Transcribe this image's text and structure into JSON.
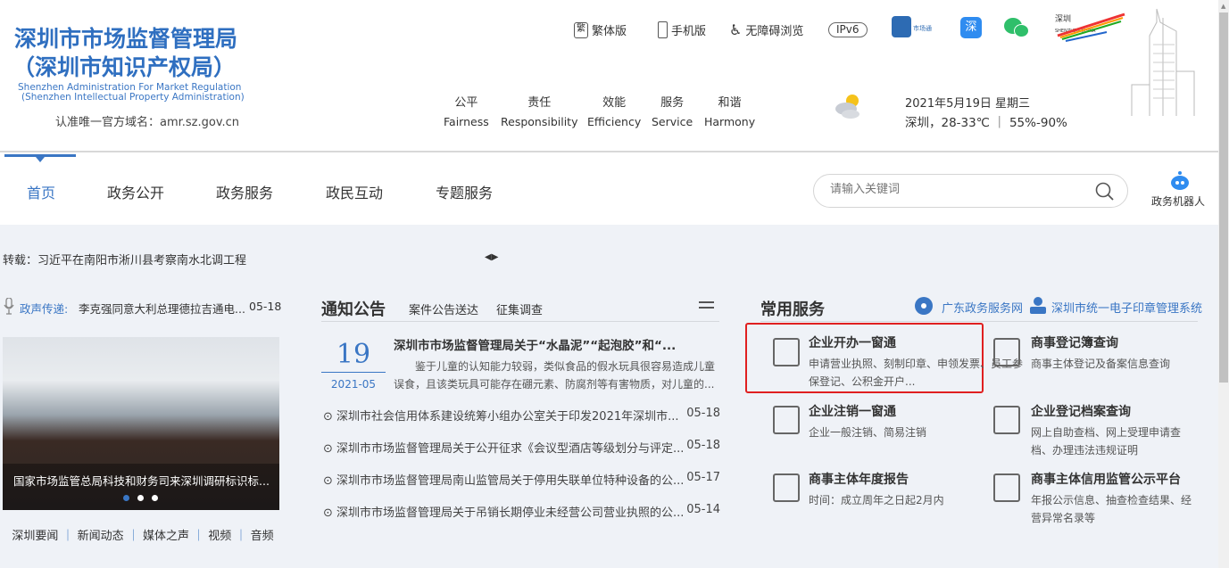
{
  "header": {
    "title_line1": "深圳市市场监督管理局",
    "title_line2": "（深圳市知识产权局）",
    "en_line1": "Shenzhen Administration For Market Regulation",
    "en_line2": "(Shenzhen Intellectual Property Administration)",
    "domain": "认准唯一官方域名：amr.sz.gov.cn",
    "tools": [
      {
        "label": "繁体版",
        "icon": "traditional-chinese-icon"
      },
      {
        "label": "手机版",
        "icon": "mobile-icon"
      },
      {
        "label": "无障碍浏览",
        "icon": "accessibility-icon"
      },
      {
        "label": "IPv6"
      }
    ],
    "apps": [
      {
        "label": "市场通",
        "icon": "shichangtong-app-icon"
      },
      {
        "label": "i深",
        "icon": "ishen-app-icon"
      },
      {
        "label": "",
        "icon": "wechat-icon"
      },
      {
        "label": "深圳 SHENZHEN CHINA",
        "icon": "shenzhen-logo"
      }
    ],
    "values": [
      {
        "cn": "公平",
        "en": "Fairness"
      },
      {
        "cn": "责任",
        "en": "Responsibility"
      },
      {
        "cn": "效能",
        "en": "Efficiency"
      },
      {
        "cn": "服务",
        "en": "Service"
      },
      {
        "cn": "和谐",
        "en": "Harmony"
      }
    ],
    "weather": {
      "icon": "partly-cloudy-icon",
      "date": "2021年5月19日 星期三",
      "line": "深圳，28-33℃ ｜ 55%-90%"
    }
  },
  "nav": {
    "items": [
      "首页",
      "政务公开",
      "政务服务",
      "政民互动",
      "专题服务"
    ],
    "active": 0,
    "search_placeholder": "请输入关键词",
    "robot": "政务机器人"
  },
  "ticker": {
    "text": "转载：习近平在南阳市淅川县考察南水北调工程"
  },
  "left": {
    "voice_label": "政声传递:",
    "voice_title": "李克强同意大利总理德拉吉通电...",
    "voice_date": "05-18",
    "slide_caption": "国家市场监管总局科技和财务司来深圳调研标识标...",
    "slide_active": 0,
    "slide_count": 3,
    "links": [
      "深圳要闻",
      "新闻动态",
      "媒体之声",
      "视频",
      "音频"
    ]
  },
  "notice": {
    "title": "通知公告",
    "tabs": [
      "案件公告送达",
      "征集调查"
    ],
    "featured": {
      "day": "19",
      "month": "2021-05",
      "title": "深圳市市场监督管理局关于“水晶泥”“起泡胶”和“...",
      "summary": "鉴于儿童的认知能力较弱，类似食品的假水玩具很容易造成儿童误食，且该类玩具可能存在硼元素、防腐剂等有害物质，对儿童的..."
    },
    "items": [
      {
        "title": "深圳市社会信用体系建设统筹小组办公室关于印发2021年深圳市...",
        "date": "05-18"
      },
      {
        "title": "深圳市市场监督管理局关于公开征求《会议型酒店等级划分与评定...",
        "date": "05-18"
      },
      {
        "title": "深圳市市场监督管理局南山监管局关于停用失联单位特种设备的公...",
        "date": "05-17"
      },
      {
        "title": "深圳市市场监督管理局关于吊销长期停业未经营公司营业执照的公...",
        "date": "05-14"
      }
    ]
  },
  "services": {
    "title": "常用服务",
    "links": [
      "广东政务服务网",
      "深圳市统一电子印章管理系统"
    ],
    "items": [
      {
        "title": "企业开办一窗通",
        "desc": "申请营业执照、刻制印章、申领发票、员工参保登记、公积金开户...",
        "icon": "building-icon",
        "highlighted": true
      },
      {
        "title": "商事登记簿查询",
        "desc": "商事主体登记及备案信息查询",
        "icon": "document-search-icon"
      },
      {
        "title": "企业注销一窗通",
        "desc": "企业一般注销、简易注销",
        "icon": "power-monitor-icon"
      },
      {
        "title": "企业登记档案查询",
        "desc": "网上自助查档、网上受理申请查档、办理违法违规证明",
        "icon": "archive-tray-icon"
      },
      {
        "title": "商事主体年度报告",
        "desc": "时间：成立周年之日起2月内",
        "icon": "report-icon"
      },
      {
        "title": "商事主体信用监管公示平台",
        "desc": "年报公示信息、抽查检查结果、经营异常名录等",
        "icon": "notice-board-icon"
      }
    ]
  },
  "colors": {
    "brand": "#2f6fc0",
    "highlight": "#e02020",
    "bg": "#eff2f7"
  }
}
